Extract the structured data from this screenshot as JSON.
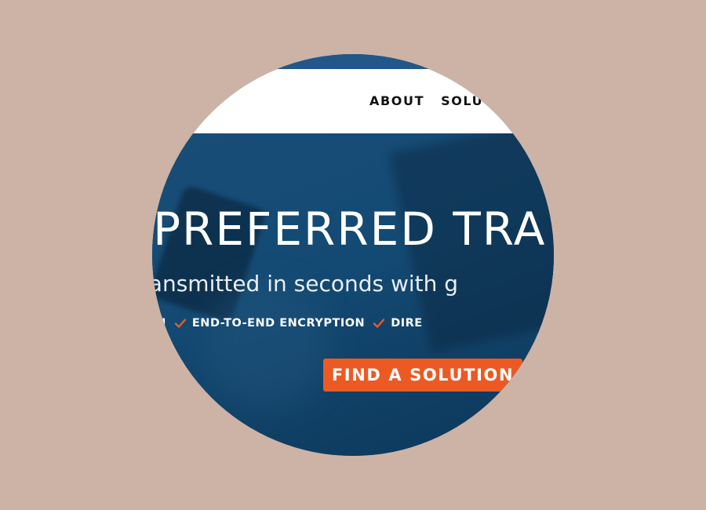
{
  "nav": {
    "items": [
      {
        "label": "ABOUT"
      },
      {
        "label": "SOLUTI"
      }
    ]
  },
  "hero": {
    "title": "E PREFERRED TRA",
    "subtitle": "page fax transmitted in seconds with g",
    "features": [
      {
        "label": "BRID FAX SOLUTION",
        "icon": "check-icon"
      },
      {
        "label": "END-TO-END ENCRYPTION",
        "icon": "check-icon"
      },
      {
        "label": "DIRE",
        "icon": "check-icon"
      }
    ],
    "cta_label": "FIND A SOLUTION"
  },
  "colors": {
    "background": "#cdb3a5",
    "navbar": "#ffffff",
    "topstrip": "#22578a",
    "hero": "#134a73",
    "accent": "#ec5a24",
    "check": "#ec5a24"
  }
}
